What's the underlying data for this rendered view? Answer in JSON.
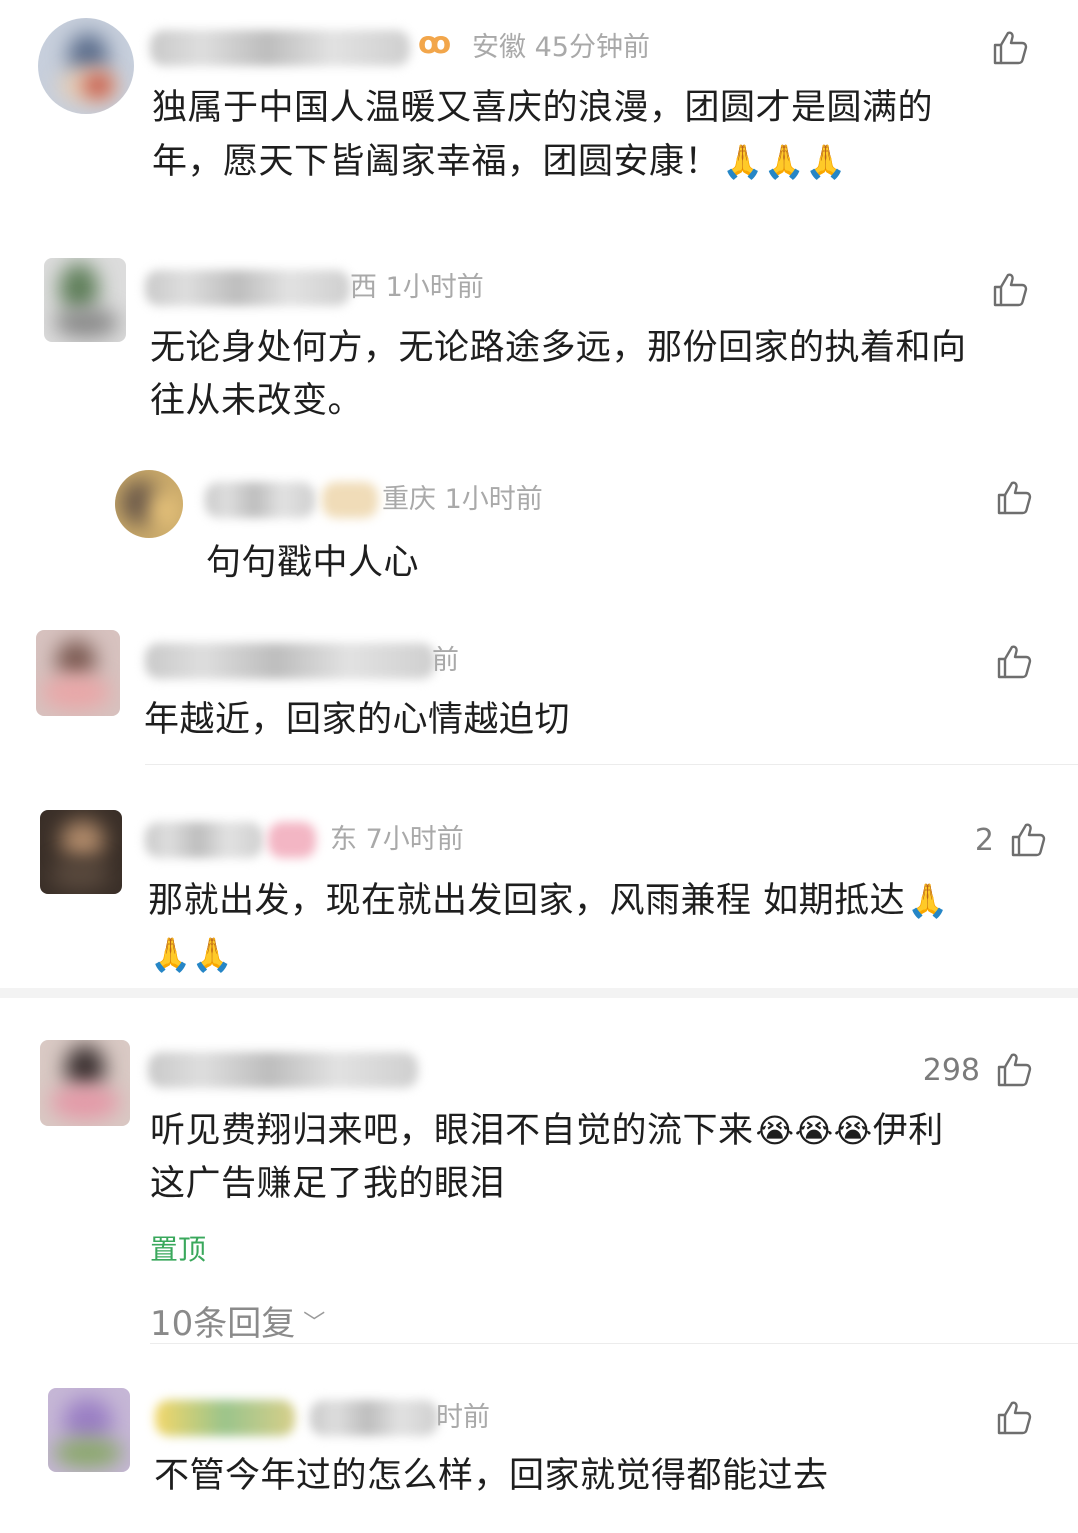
{
  "comments": [
    {
      "meta": "安徽 45分钟前",
      "text": "独属于中国人温暖又喜庆的浪漫，团圆才是圆满的年，愿天下皆阖家幸福，团圆安康！",
      "text_line1": "独属于中国人温暖又喜庆的浪漫，团圆才是圆满的",
      "text_line2": "年，愿天下皆阖家幸福，团圆安康！",
      "emoji": "🙏🙏🙏"
    },
    {
      "meta": "西 1小时前",
      "text_line1": "无论身处何方，无论路途多远，那份回家的执着和向",
      "text_line2": "往从未改变。"
    },
    {
      "meta": "重庆 1小时前",
      "text": "句句戳中人心"
    },
    {
      "meta": "前",
      "text": "年越近，回家的心情越迫切"
    },
    {
      "meta": "东 7小时前",
      "like_count": "2",
      "text_line1": "那就出发，现在就出发回家，风雨兼程 如期抵达",
      "emoji1": "🙏",
      "emoji2": "🙏🙏"
    },
    {
      "like_count": "298",
      "text_line1": "听见费翔归来吧，眼泪不自觉的流下来",
      "emoji": "😭😭😭",
      "text_line1_end": "伊利",
      "text_line2": "这广告赚足了我的眼泪",
      "pinned_label": "置顶",
      "replies_label": "10条回复",
      "replies_chevron": "﹀"
    },
    {
      "meta": "时前",
      "text": "不管今年过的怎么样，回家就觉得都能过去"
    }
  ],
  "icons": {
    "like": "thumbs-up-icon",
    "chevron": "chevron-down-icon"
  },
  "colors": {
    "meta": "#a9a9a9",
    "pinned": "#3aa85c",
    "badge": "#f2a64b"
  }
}
